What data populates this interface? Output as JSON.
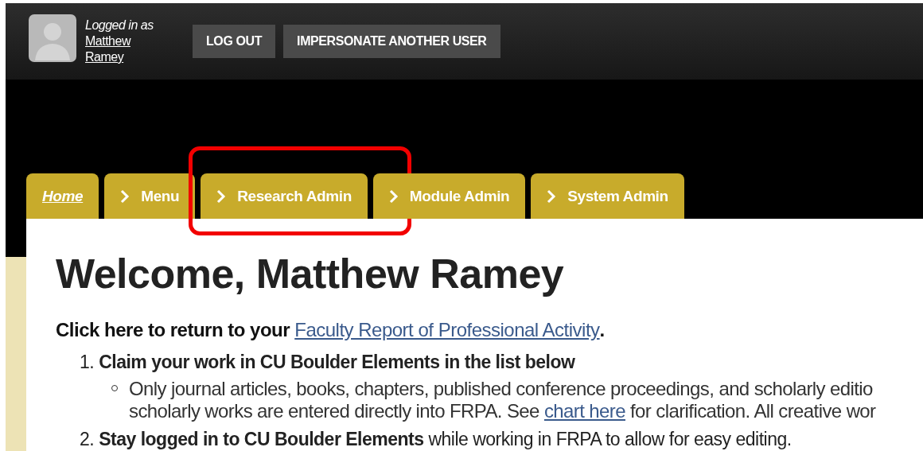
{
  "user": {
    "label": "Logged in as",
    "name_lines": [
      "Matthew",
      "Ramey"
    ]
  },
  "header_buttons": [
    "LOG OUT",
    "IMPERSONATE ANOTHER USER"
  ],
  "tabs": [
    {
      "label": "Home",
      "kind": "home",
      "highlighted": false
    },
    {
      "label": "Menu",
      "kind": "chevron",
      "highlighted": false
    },
    {
      "label": "Research Admin",
      "kind": "chevron",
      "highlighted": true
    },
    {
      "label": "Module Admin",
      "kind": "chevron",
      "highlighted": false
    },
    {
      "label": "System Admin",
      "kind": "chevron",
      "highlighted": false
    }
  ],
  "heading": "Welcome, Matthew Ramey",
  "intro": [
    {
      "kind": "text",
      "text": "Click here to return to your "
    },
    {
      "kind": "link",
      "text": "Faculty Report of Professional Activity"
    },
    {
      "kind": "text",
      "text": "."
    }
  ],
  "steps": [
    {
      "number": "1.",
      "text": "Claim your work in CU Boulder Elements in the list below",
      "bold": true,
      "bullets": [
        {
          "lines": [
            [
              {
                "kind": "text",
                "text": "Only journal articles, books, chapters, published conference proceedings, and scholarly editio"
              }
            ],
            [
              {
                "kind": "text",
                "text": "scholarly works are entered directly into FRPA. See "
              },
              {
                "kind": "link",
                "text": "chart here"
              },
              {
                "kind": "text",
                "text": " for clarification. All creative wor"
              }
            ]
          ]
        }
      ]
    },
    {
      "number": "2.",
      "text": "**Stay logged in to CU Boulder Elements** while working in FRPA to allow for easy editing.",
      "bold": false
    }
  ]
}
